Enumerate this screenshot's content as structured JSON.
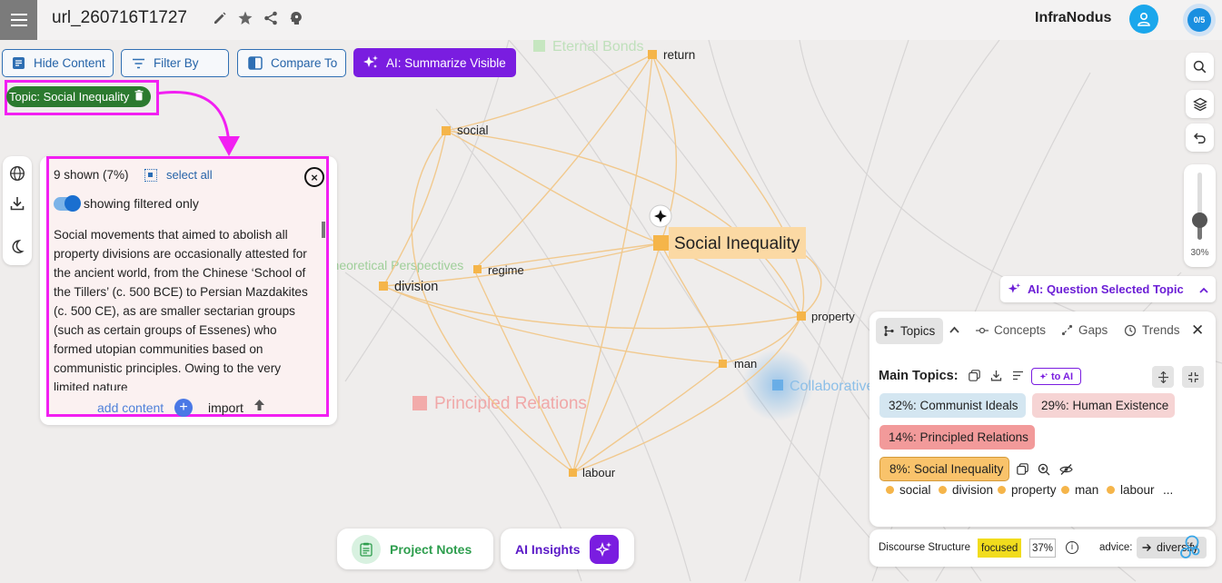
{
  "header": {
    "title": "url_260716T1727",
    "brand": "InfraNodus",
    "progress_badge": "0/5"
  },
  "toolbar": {
    "hide_content": "Hide Content",
    "filter_by": "Filter By",
    "compare_to": "Compare To",
    "ai_summarize": "AI: Summarize Visible"
  },
  "topic_filter": {
    "label": "Topic: Social Inequality"
  },
  "content_panel": {
    "shown_count": "9 shown (7%)",
    "select_all": "select all",
    "toggle_label": "showing filtered only",
    "toggle_on": true,
    "text": "Social movements that aimed to abolish all property divisions are occasionally attested for the ancient world, from the Chinese ‘School of the Tillers’ (c. 500 BCE) to Persian Mazdakites (c. 500 CE), as are smaller sectarian groups (such as certain groups of Essenes) who formed utopian communities based on communistic principles. Owing to the very limited nature",
    "add_content": "add content",
    "import": "import"
  },
  "graph": {
    "nodes": [
      {
        "label": "return",
        "kind": "node"
      },
      {
        "label": "social",
        "kind": "node"
      },
      {
        "label": "Social Inequality",
        "kind": "selected-topic"
      },
      {
        "label": "regime",
        "kind": "node"
      },
      {
        "label": "division",
        "kind": "node"
      },
      {
        "label": "property",
        "kind": "node"
      },
      {
        "label": "man",
        "kind": "node"
      },
      {
        "label": "labour",
        "kind": "node"
      }
    ],
    "cluster_labels": [
      "Eternal Bonds",
      "Theoretical Perspectives",
      "Principled Relations",
      "Collaborative"
    ]
  },
  "zoom": {
    "level_text": "30%",
    "level": 0.3
  },
  "ai_question": {
    "label": "AI: Question Selected Topic"
  },
  "topics_panel": {
    "tabs": [
      "Topics",
      "Concepts",
      "Gaps",
      "Trends"
    ],
    "active_tab": "Topics",
    "main_topics_label": "Main Topics:",
    "to_ai": "to AI",
    "topics": [
      {
        "label": "32%: Communist Ideals",
        "color": "#d4e6f1"
      },
      {
        "label": "29%: Human Existence",
        "color": "#f6d4d4"
      },
      {
        "label": "14%: Principled Relations",
        "color": "#f29a9a"
      },
      {
        "label": "8%: Social Inequality",
        "color": "#f9c36b"
      }
    ],
    "keywords": [
      "social",
      "division",
      "property",
      "man",
      "labour"
    ],
    "more": "..."
  },
  "discourse": {
    "label": "Discourse Structure",
    "badge": "focused",
    "percent": "37%",
    "advice_label": "advice:",
    "advice_value": "diversify"
  },
  "bottom": {
    "project_notes": "Project Notes",
    "ai_insights": "AI Insights"
  },
  "colors": {
    "accent_purple": "#7a1de0",
    "topic_green": "#2c7a2f",
    "highlight_magenta": "#f21ff2",
    "node_orange": "#f5b54a",
    "link_blue": "#2563a8"
  }
}
